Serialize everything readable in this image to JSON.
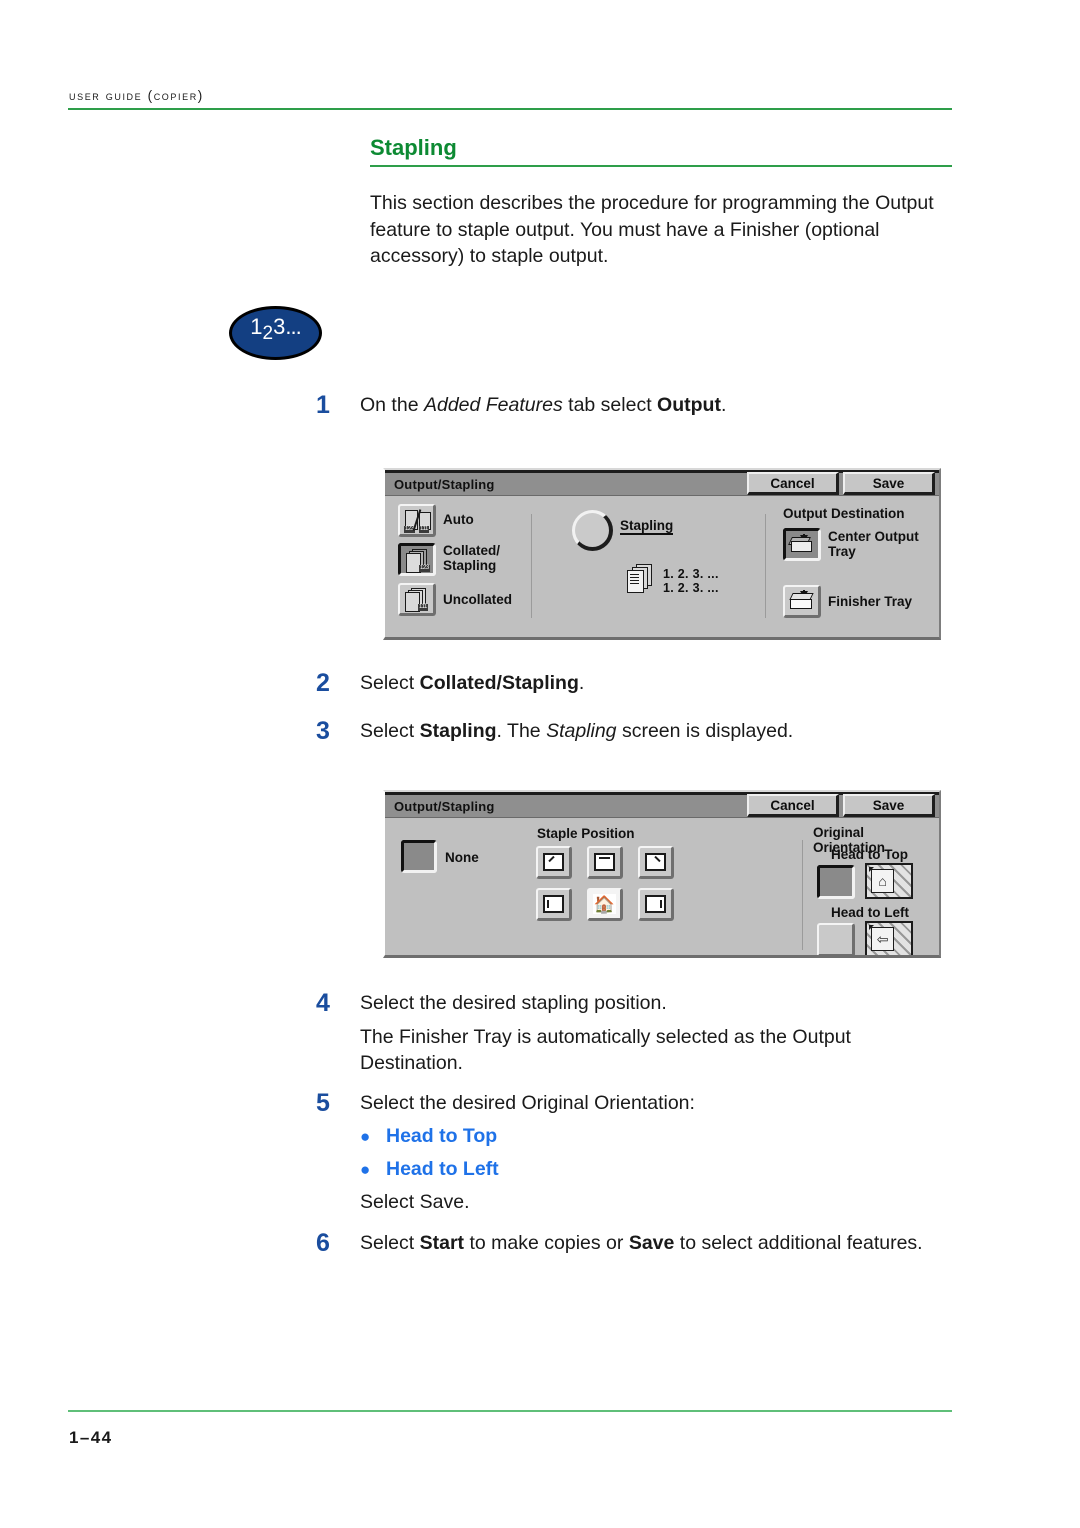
{
  "page": {
    "running_header": "USER GUIDE (COPIER)",
    "page_number": "1–44",
    "accent_green": "#2e9e4a",
    "heading_green": "#0d8a33",
    "step_blue": "#1a4d9e",
    "bullet_blue": "#1f72e8"
  },
  "section": {
    "title": "Stapling",
    "intro": "This section describes the procedure for programming the Output feature to staple output. You must have a Finisher (optional accessory) to staple output."
  },
  "badge": {
    "one": "1",
    "two": "2",
    "three": "3",
    "dots": "..."
  },
  "steps": [
    {
      "number": "1",
      "text_parts": [
        {
          "t": "On the ",
          "style": "normal"
        },
        {
          "t": "Added Features",
          "style": "italic"
        },
        {
          "t": " tab select ",
          "style": "normal"
        },
        {
          "t": "Output",
          "style": "bold"
        },
        {
          "t": ".",
          "style": "normal"
        }
      ],
      "plain": "On the Added Features tab select Output."
    },
    {
      "number": "2",
      "text_parts": [
        {
          "t": "Select ",
          "style": "normal"
        },
        {
          "t": "Collated/Stapling",
          "style": "bold"
        },
        {
          "t": ".",
          "style": "normal"
        }
      ],
      "plain": "Select Collated/Stapling."
    },
    {
      "number": "3",
      "text_parts": [
        {
          "t": "Select ",
          "style": "normal"
        },
        {
          "t": "Stapling",
          "style": "bold"
        },
        {
          "t": ". The ",
          "style": "normal"
        },
        {
          "t": "Stapling",
          "style": "italic"
        },
        {
          "t": " screen is displayed.",
          "style": "normal"
        }
      ],
      "plain": "Select Stapling. The Stapling screen is displayed."
    },
    {
      "number": "4",
      "plain": "Select the desired stapling position.",
      "sub": "The Finisher Tray is automatically selected as the Output Destination."
    },
    {
      "number": "5",
      "plain": "Select the desired Original Orientation:",
      "bullets": [
        "Head to Top",
        "Head to Left"
      ],
      "after": [
        {
          "t": "Select ",
          "style": "normal"
        },
        {
          "t": "Save",
          "style": "bold"
        },
        {
          "t": ".",
          "style": "normal"
        }
      ],
      "after_plain": "Select Save."
    },
    {
      "number": "6",
      "text_parts": [
        {
          "t": "Select ",
          "style": "normal"
        },
        {
          "t": "Start",
          "style": "bold"
        },
        {
          "t": " to make copies or ",
          "style": "normal"
        },
        {
          "t": "Save",
          "style": "bold"
        },
        {
          "t": " to select additional features.",
          "style": "normal"
        }
      ],
      "plain": "Select Start to make copies or Save to select additional features."
    }
  ],
  "panel_output": {
    "title": "Output/Stapling",
    "cancel_label": "Cancel",
    "save_label": "Save",
    "collate_options": [
      {
        "label": "Auto",
        "selected": false,
        "icon": "auto-collate-icon"
      },
      {
        "label": "Collated/\nStapling",
        "selected": true,
        "icon": "collated-stapling-icon"
      },
      {
        "label": "Uncollated",
        "selected": false,
        "icon": "uncollated-icon"
      }
    ],
    "stapling_toggle_label": "Stapling",
    "sample_lines": "1. 2. 3. ...\n1. 2. 3. ...",
    "output_destination_label": "Output Destination",
    "destinations": [
      {
        "label": "Center Output\nTray",
        "selected": true,
        "icon": "center-output-tray-icon"
      },
      {
        "label": "Finisher Tray",
        "selected": false,
        "icon": "finisher-tray-icon"
      }
    ]
  },
  "panel_staple": {
    "title": "Output/Stapling",
    "cancel_label": "Cancel",
    "save_label": "Save",
    "none_label": "None",
    "none_selected": true,
    "staple_position_label": "Staple Position",
    "staple_positions": [
      {
        "name": "top-left-diagonal",
        "mark": "corner-tl",
        "selected": false
      },
      {
        "name": "top-double",
        "mark": "top-two",
        "selected": false
      },
      {
        "name": "top-right-diagonal",
        "mark": "corner-tr",
        "selected": false
      },
      {
        "name": "left-double",
        "mark": "left-two",
        "selected": false
      },
      {
        "name": "home-position",
        "mark": "home",
        "selected": false
      },
      {
        "name": "right-double",
        "mark": "right-two",
        "selected": false
      }
    ],
    "original_orientation_label": "Original Orientation",
    "orientations": [
      {
        "label": "Head to Top",
        "selected": true,
        "preview": "head-to-top-preview"
      },
      {
        "label": "Head to Left",
        "selected": false,
        "preview": "head-to-left-preview"
      }
    ]
  }
}
